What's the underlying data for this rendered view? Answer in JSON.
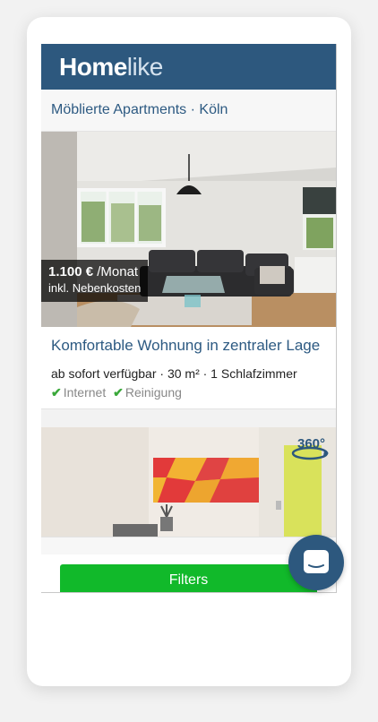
{
  "header": {
    "logo_part1": "Home",
    "logo_part2": "like"
  },
  "breadcrumb": "Möblierte Apartments · Köln",
  "listings": [
    {
      "price_amount": "1.100 €",
      "price_period": "/Monat",
      "price_note": "inkl. Nebenkosten",
      "title": "Komfortable Wohnung in zentraler Lage",
      "meta": "ab sofort verfügbar · 30 m² · 1 Schlafzimmer",
      "amenities": [
        "Internet",
        "Reinigung"
      ]
    },
    {
      "badge": "360°"
    }
  ],
  "filters_label": "Filters",
  "colors": {
    "brand": "#2d587e",
    "accent": "#11b92a",
    "title": "#2d5a82"
  },
  "icons": {
    "chat": "chat-icon",
    "check": "check-icon",
    "panorama": "360-icon"
  }
}
